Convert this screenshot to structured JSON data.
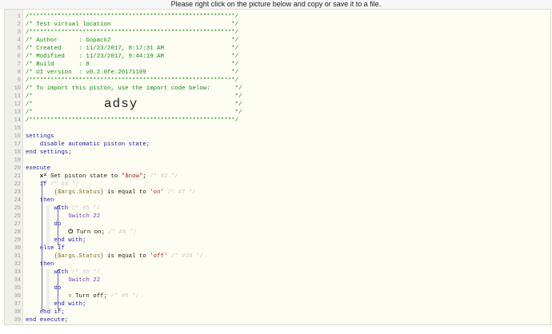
{
  "banner": "Please right click on the picture below and copy or save it to a file.",
  "lines": [
    {
      "n": "1",
      "html": "<span class='cmt'>/**********************************************************/</span>"
    },
    {
      "n": "2",
      "html": "<span class='cmt'>/* Test virtual location                                  */</span>"
    },
    {
      "n": "3",
      "html": "<span class='cmt'>/**********************************************************/</span>"
    },
    {
      "n": "4",
      "html": "<span class='cmt'>/* Author      : Gopack2                                  */</span>"
    },
    {
      "n": "5",
      "html": "<span class='cmt'>/* Created     : 11/23/2017, 8:17:31 AM                   */</span>"
    },
    {
      "n": "6",
      "html": "<span class='cmt'>/* Modified    : 11/23/2017, 9:44:19 AM                   */</span>"
    },
    {
      "n": "7",
      "html": "<span class='cmt'>/* Build       : 8                                        */</span>"
    },
    {
      "n": "8",
      "html": "<span class='cmt'>/* UI version  : v0.2.0fe.20171109                        */</span>"
    },
    {
      "n": "9",
      "html": "<span class='cmt'>/**********************************************************/</span>"
    },
    {
      "n": "10",
      "html": "<span class='cmt'>/* To import this piston, use the import code below:       */</span>"
    },
    {
      "n": "11",
      "html": "<span class='cmt'>/*                                                         */</span>"
    },
    {
      "n": "12",
      "html": "<span class='cmt'>/*                                                         */</span>"
    },
    {
      "n": "13",
      "html": "<span class='cmt'>/*                                                         */</span>"
    },
    {
      "n": "14",
      "html": "<span class='cmt'>/**********************************************************/</span>"
    },
    {
      "n": "15",
      "html": ""
    },
    {
      "n": "16",
      "html": "<span class='kw'>settings</span>"
    },
    {
      "n": "17",
      "html": "    <span class='kw'>disable automatic piston state;</span>"
    },
    {
      "n": "18",
      "html": "<span class='kw'>end settings;</span>"
    },
    {
      "n": "19",
      "html": ""
    },
    {
      "n": "20",
      "html": "<span class='kw'>execute</span>"
    },
    {
      "n": "21",
      "html": "    <span class='bold'>x²</span> <span class='fn'>Set piston state to </span><span class='str'>\"$now\"</span>; <span class='dim'>/* #2 */</span>"
    },
    {
      "n": "22",
      "html": "    <span class='kw'>if</span> <span class='dim'>/* #3 */</span>"
    },
    {
      "n": "23",
      "html": "        <span class='var'>{$args.Status}</span> <span class='fn'>is equal to</span> <span class='str'>'on'</span> <span class='dim'>/* #7 */</span>"
    },
    {
      "n": "24",
      "html": "    <span class='kw'>then</span>"
    },
    {
      "n": "25",
      "html": "        <span class='kw'>with</span> <span class='dim'>/* #5 */</span>"
    },
    {
      "n": "26",
      "html": "            <span class='dev'>Switch 22</span>"
    },
    {
      "n": "27",
      "html": "        <span class='kw'>do</span>"
    },
    {
      "n": "28",
      "html": "            <span class='bold'>⏻</span> <span class='fn'>Turn on;</span> <span class='dim'>/* #6 */</span>"
    },
    {
      "n": "29",
      "html": "        <span class='kw'>end with;</span>"
    },
    {
      "n": "30",
      "html": "    <span class='kw'>else if</span>"
    },
    {
      "n": "31",
      "html": "        <span class='var'>{$args.Status}</span> <span class='fn'>is equal to</span> <span class='str'>'off'</span> <span class='dim'>/* #10 */</span>"
    },
    {
      "n": "32",
      "html": "    <span class='kw'>then</span>"
    },
    {
      "n": "33",
      "html": "        <span class='kw'>with</span> <span class='dim'>/* #8 */</span>"
    },
    {
      "n": "34",
      "html": "            <span class='dev'>Switch 22</span>"
    },
    {
      "n": "35",
      "html": "        <span class='kw'>do</span>"
    },
    {
      "n": "36",
      "html": "            <span class='bold'>○</span> <span class='fn'>Turn off;</span> <span class='dim'>/* #9 */</span>"
    },
    {
      "n": "37",
      "html": "        <span class='kw'>end with;</span>"
    },
    {
      "n": "38",
      "html": "    <span class='kw'>end if;</span>"
    },
    {
      "n": "39",
      "html": "<span class='kw'>end execute;</span>"
    }
  ],
  "import_code": "adsy"
}
